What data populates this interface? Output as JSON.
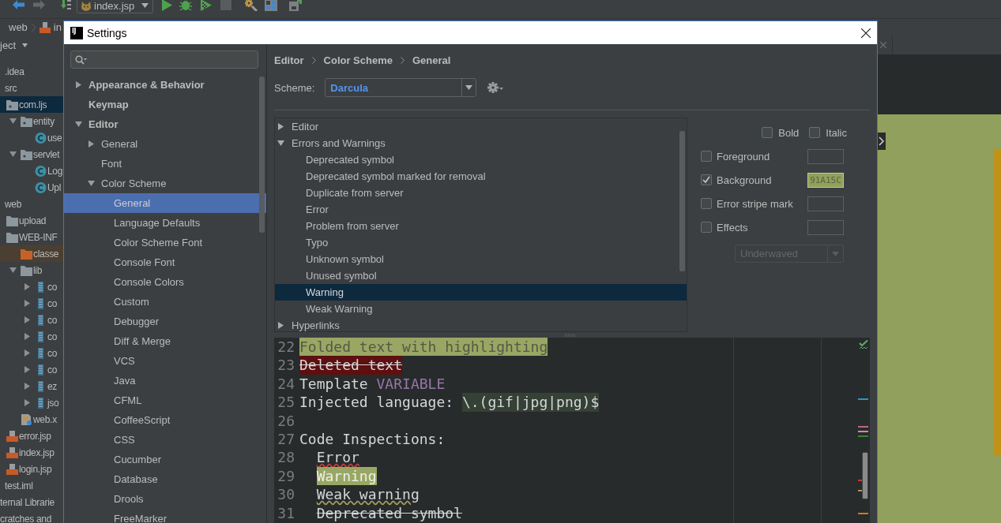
{
  "toolbar": {
    "run_config": "index.jsp"
  },
  "navbar": {
    "crumbs": [
      {
        "label": "web"
      },
      {
        "label": "in",
        "kind": "jsp"
      }
    ]
  },
  "project_panel": {
    "title": "ject",
    "tree": [
      {
        "label": ".idea",
        "selected": false
      },
      {
        "label": "src",
        "selected": false,
        "children": [
          {
            "label": "com.ljs",
            "kind": "package",
            "selected": true,
            "children": [
              {
                "label": "entity",
                "kind": "package",
                "expanded": true,
                "selected": false,
                "children": [
                  {
                    "label": "use",
                    "kind": "class",
                    "selected": false
                  }
                ]
              },
              {
                "label": "servlet",
                "kind": "package",
                "expanded": true,
                "selected": false,
                "children": [
                  {
                    "label": "Log",
                    "kind": "class",
                    "selected": false
                  },
                  {
                    "label": "Upl",
                    "kind": "class",
                    "selected": false
                  }
                ]
              }
            ]
          }
        ]
      },
      {
        "label": "web",
        "selected": false,
        "children": [
          {
            "label": "upload",
            "kind": "folder",
            "selected": false
          },
          {
            "label": "WEB-INF",
            "kind": "folder",
            "selected": false,
            "children": [
              {
                "label": "classe",
                "kind": "excluded_folder",
                "selected": false
              },
              {
                "label": "lib",
                "kind": "folder",
                "expanded": true,
                "selected": false,
                "children": [
                  {
                    "label": "co",
                    "kind": "jar",
                    "expanded": false,
                    "selected": false
                  },
                  {
                    "label": "co",
                    "kind": "jar",
                    "expanded": false,
                    "selected": false
                  },
                  {
                    "label": "co",
                    "kind": "jar",
                    "expanded": false,
                    "selected": false
                  },
                  {
                    "label": "co",
                    "kind": "jar",
                    "expanded": false,
                    "selected": false
                  },
                  {
                    "label": "co",
                    "kind": "jar",
                    "expanded": false,
                    "selected": false
                  },
                  {
                    "label": "co",
                    "kind": "jar",
                    "expanded": false,
                    "selected": false
                  },
                  {
                    "label": "ez",
                    "kind": "jar",
                    "expanded": false,
                    "selected": false
                  },
                  {
                    "label": "jso",
                    "kind": "jar",
                    "expanded": false,
                    "selected": false
                  }
                ]
              },
              {
                "label": "web.x",
                "kind": "xml",
                "selected": false
              }
            ]
          },
          {
            "label": "error.jsp",
            "kind": "jsp",
            "selected": false
          },
          {
            "label": "index.jsp",
            "kind": "jsp",
            "selected": false
          },
          {
            "label": "login.jsp",
            "kind": "jsp",
            "selected": false
          }
        ]
      },
      {
        "label": "test.iml",
        "selected": false
      }
    ],
    "root_rows": [
      {
        "label": "ternal Librarie",
        "selected": false
      },
      {
        "label": "cratches and",
        "selected": false
      }
    ]
  },
  "settings": {
    "window": {
      "title": "Settings",
      "icon_label": "IJ"
    },
    "nav": [
      {
        "label": "Appearance & Behavior",
        "expanded": false,
        "selected": false
      },
      {
        "label": "Keymap",
        "selected": false
      },
      {
        "label": "Editor",
        "expanded": true,
        "selected": false,
        "children": [
          {
            "label": "General",
            "expanded": false,
            "selected": false
          },
          {
            "label": "Font",
            "selected": false
          },
          {
            "label": "Color Scheme",
            "expanded": true,
            "selected": false,
            "children": [
              {
                "label": "General",
                "selected": true
              },
              {
                "label": "Language Defaults",
                "selected": false
              },
              {
                "label": "Color Scheme Font",
                "selected": false
              },
              {
                "label": "Console Font",
                "selected": false
              },
              {
                "label": "Console Colors",
                "selected": false
              },
              {
                "label": "Custom",
                "selected": false
              },
              {
                "label": "Debugger",
                "selected": false
              },
              {
                "label": "Diff & Merge",
                "selected": false
              },
              {
                "label": "VCS",
                "selected": false
              },
              {
                "label": "Java",
                "selected": false
              },
              {
                "label": "CFML",
                "selected": false
              },
              {
                "label": "CoffeeScript",
                "selected": false
              },
              {
                "label": "CSS",
                "selected": false
              },
              {
                "label": "Cucumber",
                "selected": false
              },
              {
                "label": "Database",
                "selected": false
              },
              {
                "label": "Drools",
                "selected": false
              },
              {
                "label": "FreeMarker",
                "selected": false
              }
            ]
          }
        ]
      }
    ],
    "breadcrumb": [
      "Editor",
      "Color Scheme",
      "General"
    ],
    "scheme": {
      "label": "Scheme:",
      "value": "Darcula"
    },
    "element_tree": [
      {
        "label": "Editor",
        "expanded": false,
        "selected": false
      },
      {
        "label": "Errors and Warnings",
        "expanded": true,
        "selected": false,
        "children": [
          {
            "label": "Deprecated symbol",
            "selected": false
          },
          {
            "label": "Deprecated symbol marked for removal",
            "selected": false
          },
          {
            "label": "Duplicate from server",
            "selected": false
          },
          {
            "label": "Error",
            "selected": false
          },
          {
            "label": "Problem from server",
            "selected": false
          },
          {
            "label": "Typo",
            "selected": false
          },
          {
            "label": "Unknown symbol",
            "selected": false
          },
          {
            "label": "Unused symbol",
            "selected": false
          },
          {
            "label": "Warning",
            "selected": true
          },
          {
            "label": "Weak Warning",
            "selected": false
          }
        ]
      },
      {
        "label": "Hyperlinks",
        "expanded": false,
        "selected": false
      }
    ],
    "attributes": {
      "font_styles": [
        {
          "label": "Bold",
          "checked": false
        },
        {
          "label": "Italic",
          "checked": false
        }
      ],
      "colors": [
        {
          "label": "Foreground",
          "checked": false
        },
        {
          "label": "Background",
          "checked": true,
          "value": "91A15C",
          "color": "#91a15c"
        },
        {
          "label": "Error stripe mark",
          "checked": false
        },
        {
          "label": "Effects",
          "checked": false
        }
      ],
      "effect_type": {
        "value": "Underwaved",
        "disabled": true
      }
    },
    "preview": {
      "lines": [
        {
          "number": "22",
          "segments": [
            {
              "text": "Folded text with highlighting",
              "kind": "folded"
            }
          ]
        },
        {
          "number": "23",
          "segments": [
            {
              "text": "Deleted text",
              "kind": "deleted"
            }
          ]
        },
        {
          "number": "24",
          "segments": [
            {
              "text": "Template",
              "kind": "plain"
            },
            {
              "text": "VARIABLE",
              "kind": "template_variable"
            }
          ]
        },
        {
          "number": "25",
          "segments": [
            {
              "text": "Injected language:",
              "kind": "plain"
            },
            {
              "text": "\\.(gif|jpg|png)$",
              "kind": "injected"
            }
          ]
        },
        {
          "number": "26"
        },
        {
          "number": "27",
          "segments": [
            {
              "text": "Code Inspections:",
              "kind": "plain"
            }
          ]
        },
        {
          "number": "28",
          "indent": true,
          "segments": [
            {
              "text": "Error",
              "kind": "error"
            }
          ]
        },
        {
          "number": "29",
          "indent": true,
          "segments": [
            {
              "text": "Warning",
              "kind": "warning"
            }
          ]
        },
        {
          "number": "30",
          "indent": true,
          "segments": [
            {
              "text": "Weak warning",
              "kind": "weak_warning"
            }
          ]
        },
        {
          "number": "31",
          "indent": true,
          "segments": [
            {
              "text": "Deprecated symbol",
              "kind": "deprecated"
            }
          ]
        }
      ]
    }
  }
}
